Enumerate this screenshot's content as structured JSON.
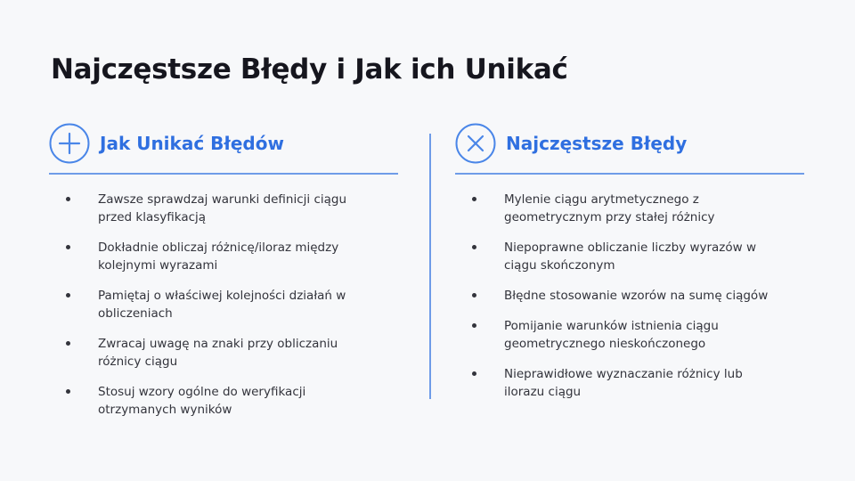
{
  "slide": {
    "title": "Najczęstsze Błędy i Jak ich Unikać"
  },
  "columns": [
    {
      "title": "Jak Unikać Błędów",
      "icon": "plus-circle-icon",
      "accent": "#2f6fe0",
      "items": [
        "Zawsze sprawdzaj warunki definicji ciągu przed klasyfikacją",
        "Dokładnie obliczaj różnicę/iloraz między kolejnymi wyrazami",
        "Pamiętaj o właściwej kolejności działań w obliczeniach",
        "Zwracaj uwagę na znaki przy obliczaniu różnicy ciągu",
        "Stosuj wzory ogólne do weryfikacji otrzymanych wyników"
      ]
    },
    {
      "title": "Najczęstsze Błędy",
      "icon": "x-circle-icon",
      "accent": "#2f6fe0",
      "items": [
        "Mylenie ciągu arytmetycznego z geometrycznym przy stałej różnicy",
        "Niepoprawne obliczanie liczby wyrazów w ciągu skończonym",
        "Błędne stosowanie wzorów na sumę ciągów",
        "Pomijanie warunków istnienia ciągu geometrycznego nieskończonego",
        "Nieprawidłowe wyznaczanie różnicy lub ilorazu ciągu"
      ]
    }
  ],
  "colors": {
    "background": "#f7f8fa",
    "accent": "#2f6fe0",
    "rule": "#6f9ce8",
    "title_text": "#16161e",
    "body_text": "#33343c"
  }
}
